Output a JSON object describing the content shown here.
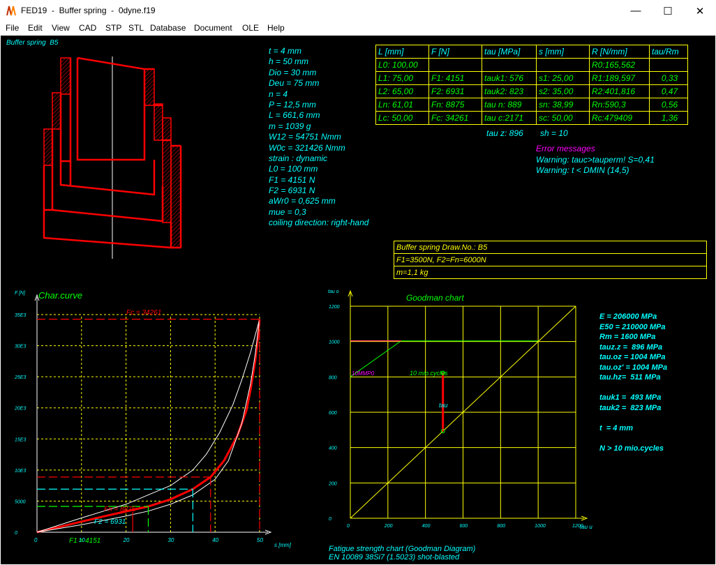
{
  "window": {
    "title": "FED19  -  Buffer spring  -  0dyne.f19",
    "minimize_glyph": "—",
    "maximize_glyph": "☐",
    "close_glyph": "✕",
    "icon": "fed19-app-icon"
  },
  "menu": [
    "File",
    "Edit",
    "View",
    "CAD",
    "STP",
    "STL",
    "Database",
    "Document",
    "OLE",
    "Help"
  ],
  "drawing": {
    "label": "Buffer spring  B5"
  },
  "params": [
    "t = 4 mm",
    "h = 50 mm",
    "Dio = 30 mm",
    "Deu = 75 mm",
    "n = 4",
    "P = 12,5 mm",
    "L = 661,6 mm",
    "m = 1039 g",
    "W12 = 54751 Nmm",
    "W0c = 321426 Nmm",
    "strain : dynamic",
    "L0 = 100 mm",
    "F1 = 4151 N",
    "F2 = 6931 N",
    "aWr0 = 0,625 mm",
    "mue = 0,3",
    "coiling direction: right-hand"
  ],
  "results_table": {
    "headers": [
      "L [mm]",
      "F [N]",
      "tau [MPa]",
      "s [mm]",
      "R [N/mm]",
      "tau/Rm"
    ],
    "rows": [
      [
        "L0: 100,00",
        "",
        "",
        "",
        "R0:165,562",
        ""
      ],
      [
        "L1:  75,00",
        "F1: 4151",
        "tauk1: 576",
        "s1:  25,00",
        "R1:189,597",
        "0,33"
      ],
      [
        "L2:  65,00",
        "F2: 6931",
        "tauk2: 823",
        "s2:  35,00",
        "R2:401,816",
        "0,47"
      ],
      [
        "Ln:  61,01",
        "Fn: 8875",
        "tau n: 889",
        "sn:  38,99",
        "Rn:590,3",
        "0,56"
      ],
      [
        "Lc:  50,00",
        "Fc: 34261",
        "tau c:2171",
        "sc:  50,00",
        "Rc:479409",
        "1,36"
      ]
    ]
  },
  "extra": {
    "tau_z": "tau z: 896",
    "sh": "sh = 10"
  },
  "errors": {
    "title": "Error messages",
    "lines": [
      "Warning: tauc>tauperm! S=0,41",
      "Warning: t < DMIN (14,5)"
    ]
  },
  "drawing_box": {
    "rows": [
      "Buffer spring  Draw.No.: B5",
      "F1=3500N, F2=Fn=6000N",
      "m=1,1 kg"
    ]
  },
  "char_curve": {
    "title": "Char.curve",
    "y_unit": "F [N]",
    "x_unit": "s [mm]",
    "fc_label": "Fc = 34261",
    "fn_label": "Fn = 8875",
    "f2_label": "F2 = 6931",
    "f1_label": "F1 = 4151"
  },
  "goodman": {
    "title": "Goodman chart",
    "y_unit": "tau o",
    "x_unit": "tau u [MPa]",
    "cycles_label": "10 mio.cycles",
    "limit_label": "10MMP0",
    "tau_label": "tau"
  },
  "material": [
    "E = 206000 MPa",
    "E50 = 210000 MPa",
    "Rm = 1600 MPa",
    "tauz.z =  896 MPa",
    "tau.oz = 1004 MPa",
    "tau.oz' = 1004 MPa",
    "tau.hz=  511 MPa",
    "",
    "tauk1 =  493 MPa",
    "tauk2 =  823 MPa",
    "",
    "t  = 4 mm",
    "",
    "N > 10 mio.cycles"
  ],
  "footer": {
    "line1": "Fatigue strength chart (Goodman Diagram)",
    "line2": "EN 10089 38Si7 (1.5023) shot-blasted"
  },
  "chart_data": [
    {
      "type": "line",
      "title": "Char.curve",
      "xlabel": "s [mm]",
      "ylabel": "F [N]",
      "xlim": [
        0,
        50
      ],
      "ylim": [
        0,
        35000
      ],
      "x_ticks": [
        "0",
        "10",
        "20",
        "30",
        "40",
        "50"
      ],
      "y_ticks": [
        "0",
        "5000",
        "10E3",
        "15E3",
        "20E3",
        "25E3",
        "30E3",
        "35E3"
      ],
      "grid": true,
      "series": [
        {
          "name": "",
          "color": "#ff0000",
          "x": [
            0,
            5,
            10,
            15,
            20,
            25,
            30,
            35,
            38.99,
            42,
            45,
            47,
            48,
            49,
            49.5,
            50
          ],
          "y": [
            0,
            850,
            1700,
            2550,
            3350,
            4151,
            5300,
            6931,
            8875,
            11500,
            15500,
            19500,
            23000,
            27500,
            30500,
            34261
          ]
        },
        {
          "name": "",
          "color": "#ffffff",
          "x": [
            0,
            10,
            20,
            25,
            30,
            35,
            40,
            43,
            46,
            48,
            49,
            50
          ],
          "y": [
            0,
            1200,
            2600,
            3400,
            4500,
            6000,
            8500,
            11500,
            17500,
            24000,
            28500,
            34261
          ]
        },
        {
          "name": "",
          "color": "#ffffff",
          "x": [
            0,
            10,
            20,
            30,
            35,
            38,
            41,
            44,
            46,
            48,
            50
          ],
          "y": [
            0,
            2300,
            4500,
            7500,
            10000,
            12500,
            16000,
            20500,
            24500,
            29000,
            34261
          ]
        }
      ],
      "markers": {
        "s1": 25,
        "s2": 35,
        "sn": 38.99,
        "sc": 50,
        "F1": 4151,
        "F2": 6931,
        "Fn": 8875,
        "Fc": 34261
      }
    },
    {
      "type": "line",
      "title": "Goodman chart",
      "xlabel": "tau u [MPa]",
      "ylabel": "tau o",
      "xlim": [
        0,
        1200
      ],
      "ylim": [
        0,
        1200
      ],
      "x_ticks": [
        "0",
        "200",
        "400",
        "600",
        "800",
        "1000",
        "1200"
      ],
      "y_ticks": [
        "0",
        "200",
        "400",
        "600",
        "800",
        "1000",
        "1200"
      ],
      "grid": true,
      "series": [
        {
          "name": "",
          "color": "#ffff00",
          "x": [
            0,
            1200
          ],
          "y": [
            0,
            1200
          ]
        },
        {
          "name": "10 mio.cycles",
          "color": "#00ff00",
          "x": [
            0,
            270,
            1000
          ],
          "y": [
            800,
            1004,
            1004
          ]
        },
        {
          "name": "tau",
          "color": "#ff0000",
          "x": [
            493,
            493
          ],
          "y": [
            493,
            823
          ]
        }
      ]
    }
  ]
}
